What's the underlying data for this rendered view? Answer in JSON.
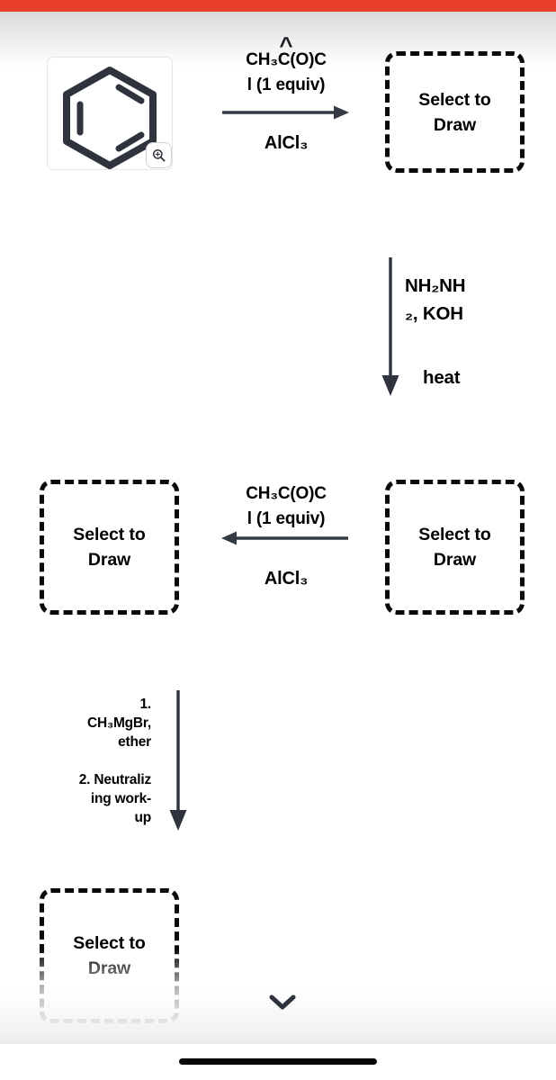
{
  "app": {
    "top_bar_color": "#E8402A",
    "background_color": "#FFFFFF",
    "ink_color": "#2E333D"
  },
  "structure": {
    "name": "benzene",
    "tile_label": "benzene-structure",
    "zoom_icon": "magnify-icon"
  },
  "answer_boxes": [
    {
      "id": "answer-box-1",
      "line1": "Select to",
      "line2": "Draw"
    },
    {
      "id": "answer-box-2",
      "line1": "Select to",
      "line2": "Draw"
    },
    {
      "id": "answer-box-3",
      "line1": "Select to",
      "line2": "Draw"
    },
    {
      "id": "answer-box-4",
      "line1": "Select to",
      "line2": "Draw"
    }
  ],
  "reactions": {
    "step1": {
      "caret": "^",
      "above_line1": "CH₃C(O)C",
      "above_line2": "l (1 equiv)",
      "below": "AlCl₃",
      "arrow_direction": "right"
    },
    "step2": {
      "line1": "NH₂NH",
      "line2": "₂, KOH",
      "line3": "heat",
      "arrow_direction": "down"
    },
    "step3": {
      "above_line1": "CH₃C(O)C",
      "above_line2": "l (1 equiv)",
      "below": "AlCl₃",
      "arrow_direction": "left"
    },
    "step4": {
      "step1_line1": "1.",
      "step1_line2": "CH₃MgBr,",
      "step1_line3": "ether",
      "step2_line1": "2. Neutraliz",
      "step2_line2": "ing work-",
      "step2_line3": "up",
      "arrow_direction": "down"
    }
  },
  "footer": {
    "scroll_icon": "chevron-down-icon",
    "home_indicator": "home-indicator"
  }
}
